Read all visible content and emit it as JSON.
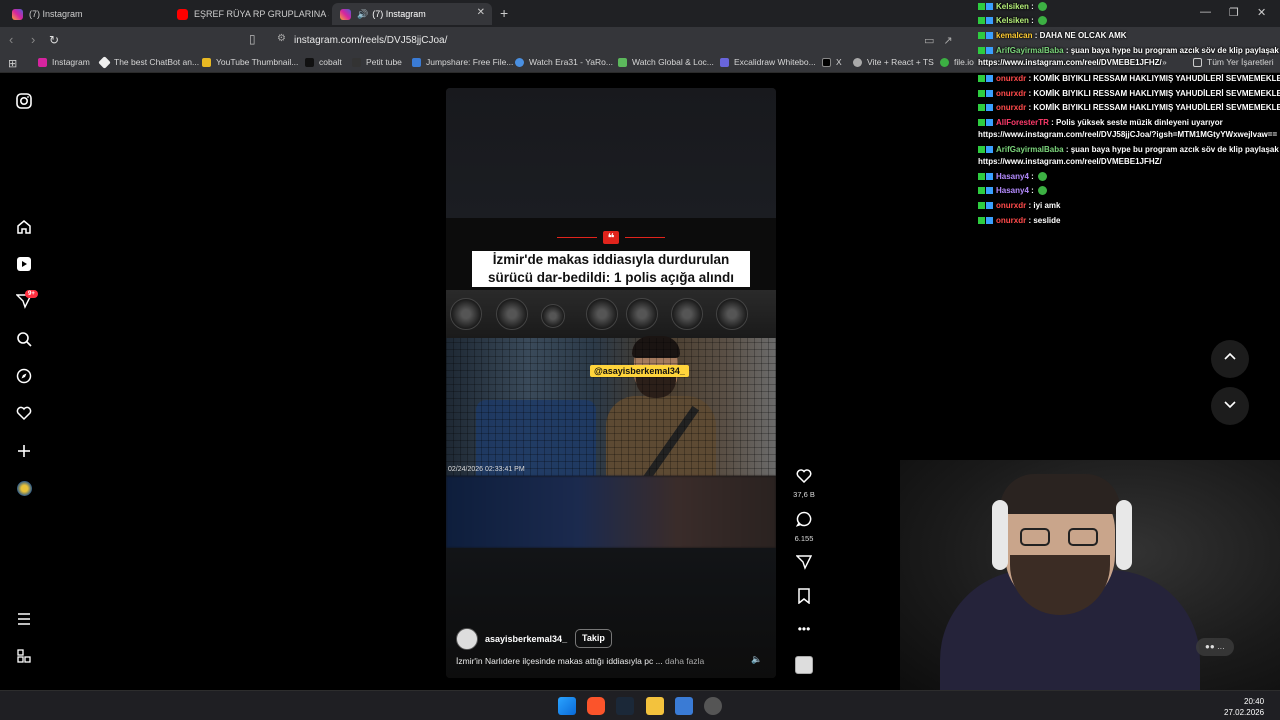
{
  "browser": {
    "tabs": [
      {
        "label": "(7) Instagram",
        "active": false
      },
      {
        "label": "EŞREF RÜYA RP GRUPLARINA SIZDIM",
        "active": false
      },
      {
        "label": "(7) Instagram",
        "active": true
      }
    ],
    "new_tab": "+",
    "url": "instagram.com/reels/DVJ58jjCJoa/",
    "bookmarks": [
      "Instagram",
      "The best ChatBot an...",
      "YouTube Thumbnail...",
      "cobalt",
      "Petit tube",
      "Jumpshare: Free File...",
      "Watch Era31 - YaRo...",
      "Watch Global & Loc...",
      "Excalidraw Whitebo...",
      "X",
      "Vite + React + TS",
      "file.io"
    ],
    "all_bookmarks": "Tüm Yer İşaretleri",
    "more_bookmarks": "»"
  },
  "reel": {
    "headline_line1": "İzmir'de makas iddiasıyla durdurulan",
    "headline_line2": "sürücü dar-bedildi: 1 polis açığa alındı",
    "overlay_tag": "@asayisberkemal34_",
    "timestamp": "02/24/2026 02:33:41 PM",
    "author": "asayisberkemal34_",
    "follow_label": "Takip",
    "caption": "İzmir'in Narlıdere ilçesinde makas attığı iddiasıyla pc ...",
    "more_label": "daha fazla"
  },
  "actions": {
    "likes": "37,6 B",
    "comments": "6.155"
  },
  "chat": [
    {
      "user": "Kelsiken",
      "msg": "",
      "color": "#b6f07a",
      "emote": true
    },
    {
      "user": "Kelsiken",
      "msg": "",
      "color": "#b6f07a",
      "emote": true
    },
    {
      "user": "kemalcan",
      "msg": "DAHA NE OLCAK AMK",
      "color": "#ffcc33",
      "emote": false
    },
    {
      "user": "ArifGayirmalBaba",
      "msg": "şuan baya hype bu program azcık söv de klip paylaşak abi",
      "color": "#7cd67c",
      "emote": false
    },
    {
      "user": "",
      "msg": "https://www.instagram.com/reel/DVMEBE1JFHZ/",
      "color": "#ffffff",
      "emote": false
    },
    {
      "user": "onurxdr",
      "msg": "KOMİK BIYIKLI RESSAM HAKLIYMIŞ YAHUDİLERİ SEVMEMEKLE",
      "color": "#ff4a4a",
      "emote": false
    },
    {
      "user": "onurxdr",
      "msg": "KOMİK BIYIKLI RESSAM HAKLIYMIŞ YAHUDİLERİ SEVMEMEKLE",
      "color": "#ff4a4a",
      "emote": false
    },
    {
      "user": "onurxdr",
      "msg": "KOMİK BIYIKLI RESSAM HAKLIYMIŞ YAHUDİLERİ SEVMEMEKLE",
      "color": "#ff4a4a",
      "emote": false
    },
    {
      "user": "AllForesterTR",
      "msg": "Polis yüksek seste müzik dinleyeni uyarıyor",
      "color": "#ff3b6b",
      "emote": false
    },
    {
      "user": "",
      "msg": "https://www.instagram.com/reel/DVJ58jjCJoa/?igsh=MTM1MGtyYWxwejlvaw==",
      "color": "#ffffff",
      "emote": false
    },
    {
      "user": "ArifGayirmalBaba",
      "msg": "şuan baya hype bu program azcık söv de klip paylaşak abi",
      "color": "#7cd67c",
      "emote": false
    },
    {
      "user": "",
      "msg": "https://www.instagram.com/reel/DVMEBE1JFHZ/",
      "color": "#ffffff",
      "emote": false
    },
    {
      "user": "Hasany4",
      "msg": "",
      "color": "#b58cff",
      "emote": true
    },
    {
      "user": "Hasany4",
      "msg": "",
      "color": "#b58cff",
      "emote": true
    },
    {
      "user": "onurxdr",
      "msg": "iyi amk",
      "color": "#ff4a4a",
      "emote": false
    },
    {
      "user": "onurxdr",
      "msg": "seslide",
      "color": "#ff4a4a",
      "emote": false
    }
  ],
  "taskbar": {
    "time": "20:40",
    "date": "27.02.2026"
  },
  "colors": {
    "instagram_red": "#ff3040",
    "news_red": "#e0241c",
    "tag_yellow": "#ffd43b"
  },
  "icons": {
    "notifications_badge": "9+"
  }
}
